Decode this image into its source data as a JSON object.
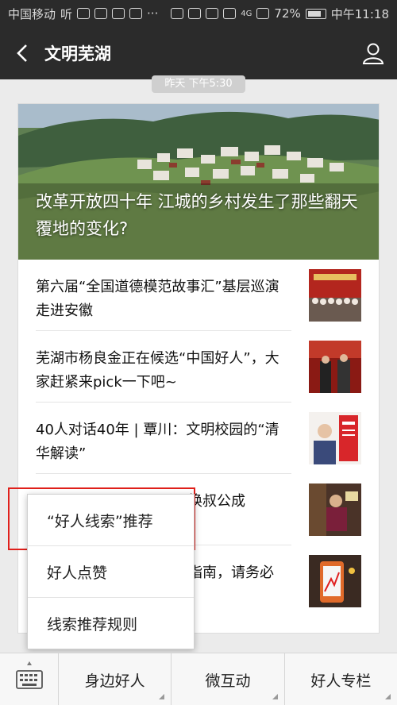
{
  "status_bar": {
    "carrier": "中国移动",
    "carrier_extra": "听",
    "more": "···",
    "network": "4G",
    "battery": "72%",
    "time": "中午11:18"
  },
  "header": {
    "title": "文明芜湖",
    "back_icon": "chevron-left-icon",
    "profile_icon": "person-icon"
  },
  "timestamp": "昨天 下午5:30",
  "hero": {
    "title": "改革开放四十年 江城的乡村发生了那些翻天覆地的变化?"
  },
  "articles": [
    {
      "title": "第六届“全国道德模范故事汇”基层巡演走进安徽"
    },
    {
      "title": "芜湖市杨良金正在候选“中国好人”，大家赶紧来pick一下吧~"
    },
    {
      "title": "40人对话40年 | 覃川：文明校园的“清华解读”"
    },
    {
      "title": "换叔公成"
    },
    {
      "title": "指南，请务必"
    }
  ],
  "popup": {
    "items": [
      "“好人线索”推荐",
      "好人点赞",
      "线索推荐规则"
    ]
  },
  "bottom_menu": {
    "keyboard_icon": "keyboard-icon",
    "items": [
      "身边好人",
      "微互动",
      "好人专栏"
    ]
  },
  "colors": {
    "header_bg": "#2b2b2b",
    "highlight": "#e0201b"
  }
}
